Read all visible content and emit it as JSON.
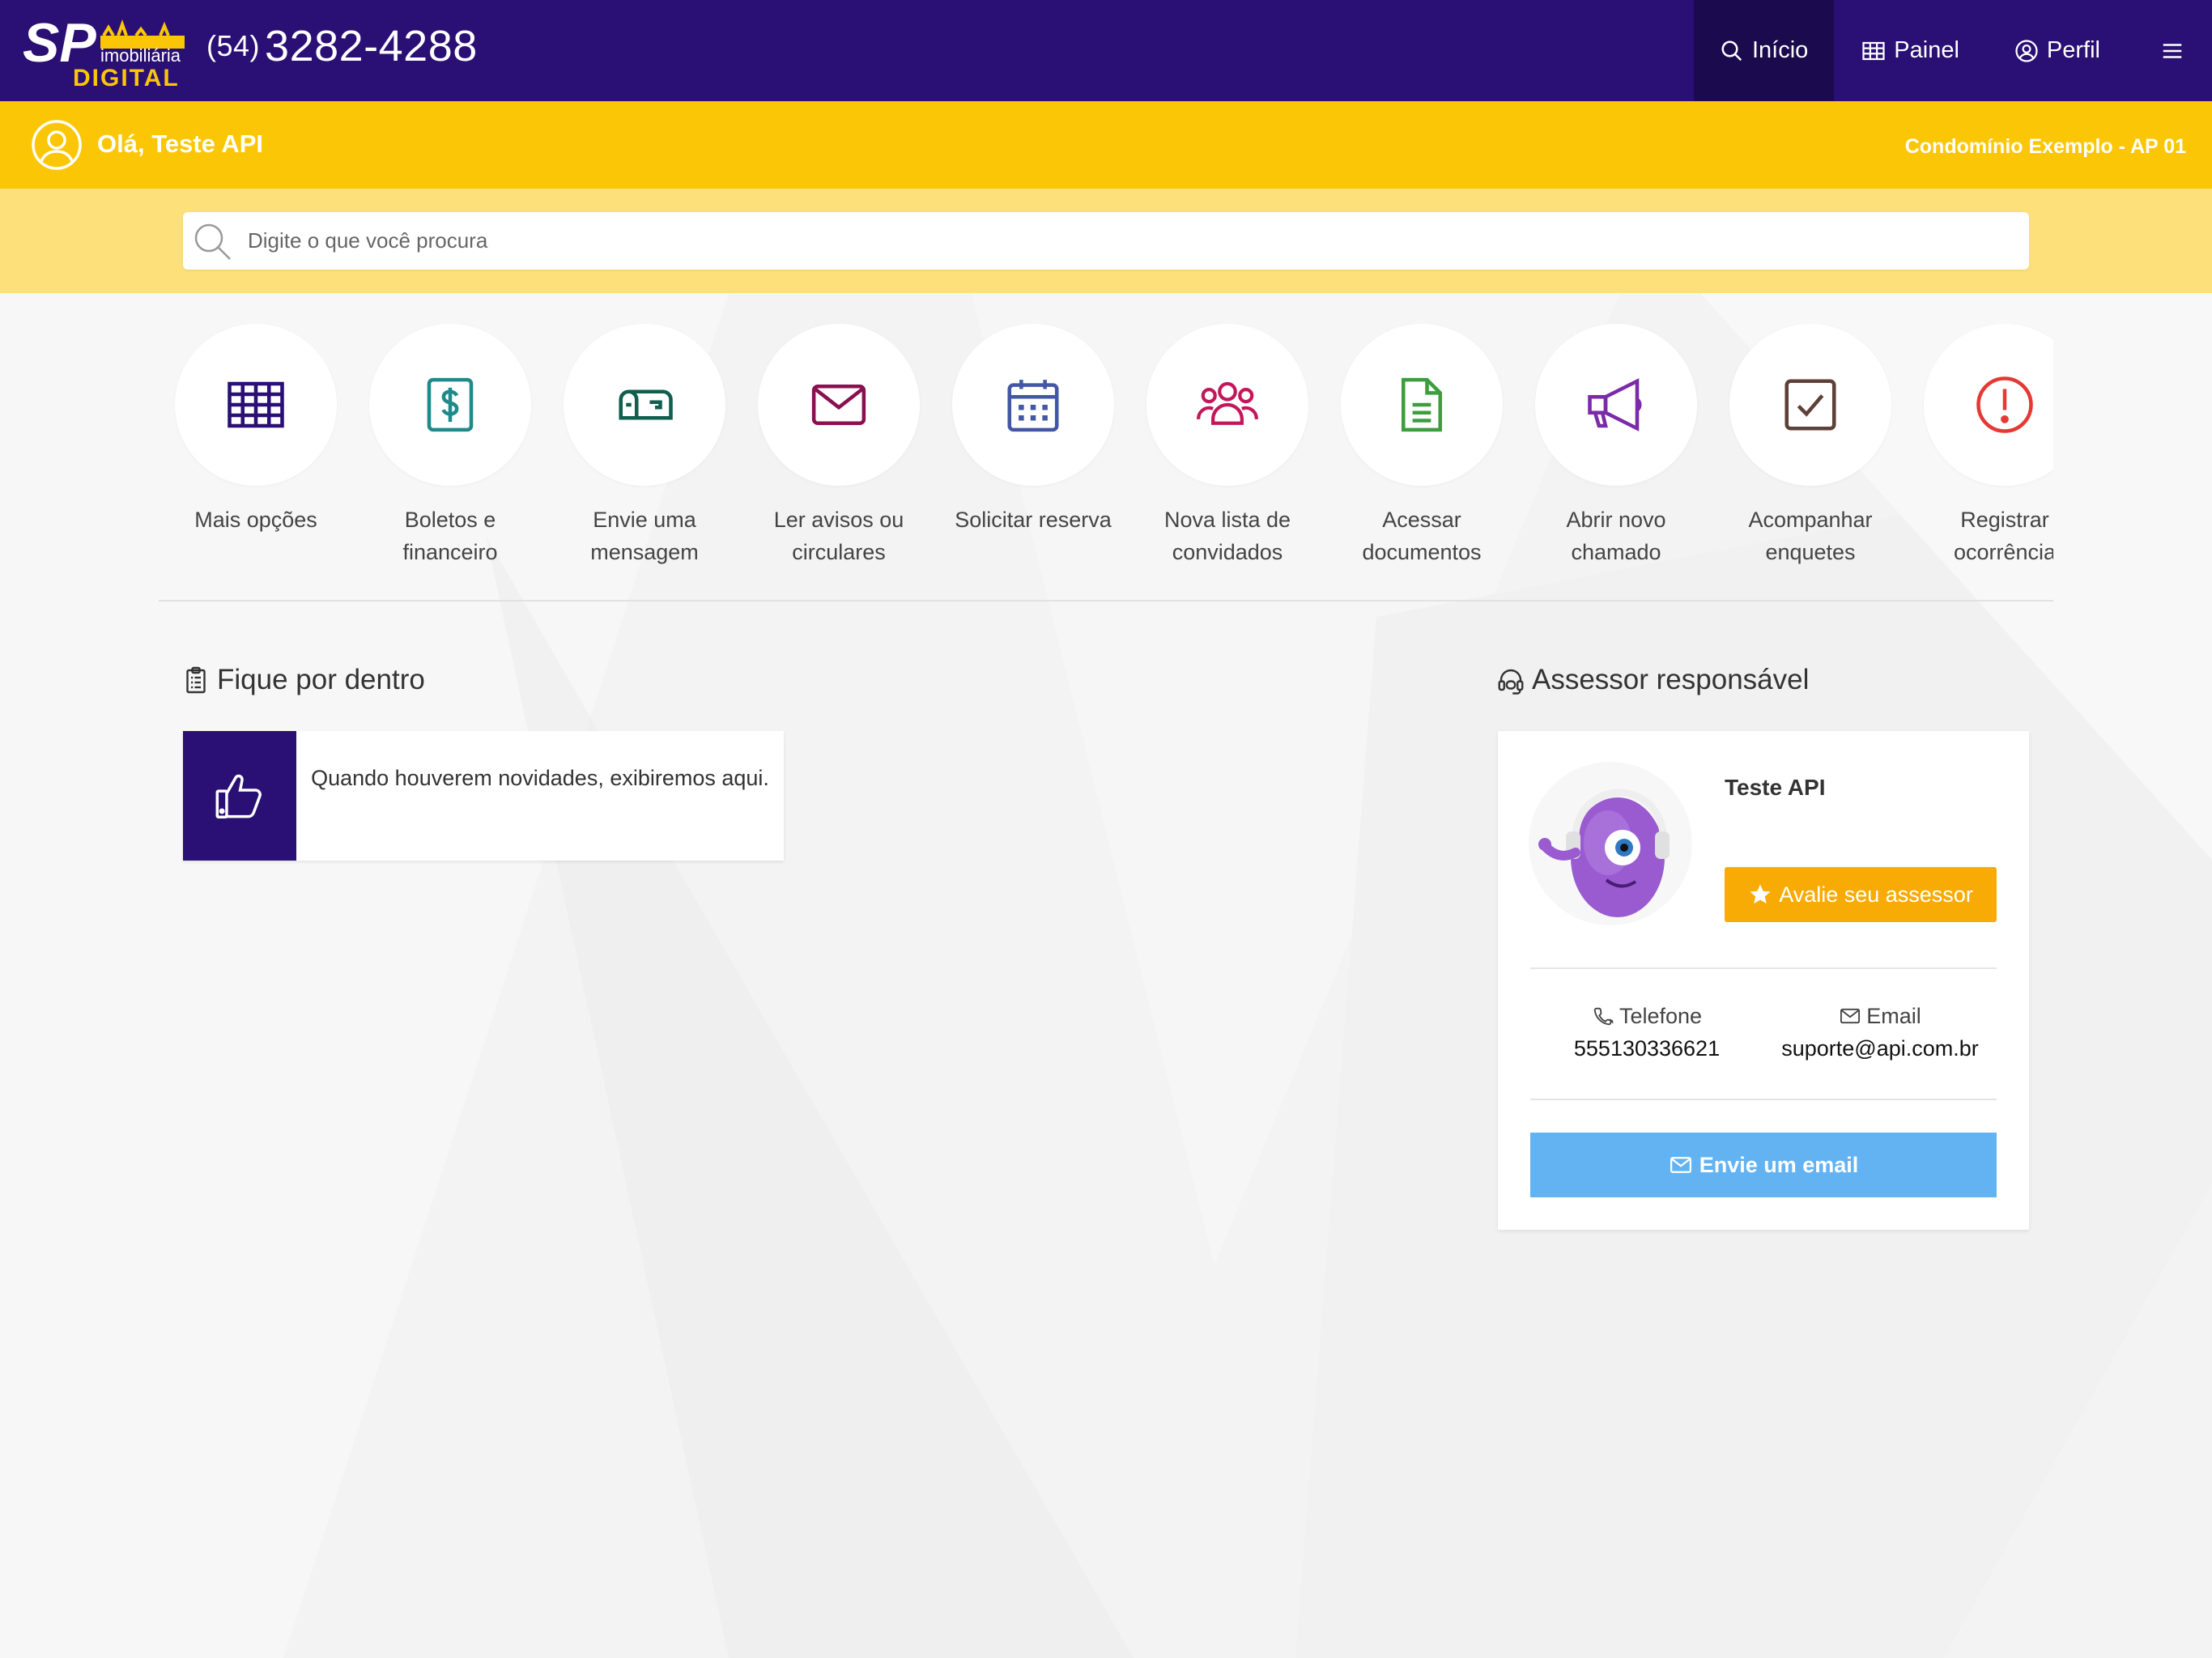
{
  "header": {
    "logo_main": "SP",
    "logo_sub": "imobiliária",
    "logo_brand": "DIGITAL",
    "phone_ddd": "(54)",
    "phone_number": "3282-4288",
    "nav": [
      {
        "label": "Início",
        "icon": "search-icon"
      },
      {
        "label": "Painel",
        "icon": "grid-icon"
      },
      {
        "label": "Perfil",
        "icon": "user-circle-icon"
      },
      {
        "label": "",
        "icon": "hamburger-menu-icon"
      }
    ]
  },
  "greeting": {
    "text": "Olá, Teste API",
    "unit": "Condomínio Exemplo - AP 01"
  },
  "search": {
    "placeholder": "Digite o que você procura"
  },
  "actions": [
    {
      "label": "Mais opções",
      "icon": "grid-icon",
      "color": "#2a0f74"
    },
    {
      "label": "Boletos e financeiro",
      "icon": "dollar-icon",
      "color": "#1f8a8a"
    },
    {
      "label": "Envie uma mensagem",
      "icon": "mailbox-icon",
      "color": "#0f5e4e"
    },
    {
      "label": "Ler avisos ou circulares",
      "icon": "envelope-icon",
      "color": "#8a1050"
    },
    {
      "label": "Solicitar reserva",
      "icon": "calendar-icon",
      "color": "#4257a5"
    },
    {
      "label": "Nova lista de convidados",
      "icon": "users-icon",
      "color": "#c2185b"
    },
    {
      "label": "Acessar documentos",
      "icon": "document-icon",
      "color": "#3d9e3d"
    },
    {
      "label": "Abrir novo chamado",
      "icon": "megaphone-icon",
      "color": "#7b2aa8"
    },
    {
      "label": "Acompanhar enquetes",
      "icon": "checkbox-icon",
      "color": "#5d4037"
    },
    {
      "label": "Registrar ocorrência",
      "icon": "alert-icon",
      "color": "#e53935"
    }
  ],
  "news": {
    "title": "Fique por dentro",
    "empty_text": "Quando houverem novidades, exibiremos aqui."
  },
  "advisor": {
    "title": "Assessor responsável",
    "name": "Teste API",
    "rate_label": "Avalie seu assessor",
    "phone_label": "Telefone",
    "phone_value": "555130336621",
    "email_label": "Email",
    "email_value": "suporte@api.com.br",
    "email_button": "Envie um email"
  },
  "colors": {
    "primary": "#2a0f74",
    "yellow": "#fbc605",
    "yellow_light": "#fee07a",
    "orange": "#f9ab05",
    "blue": "#63b3f2"
  }
}
